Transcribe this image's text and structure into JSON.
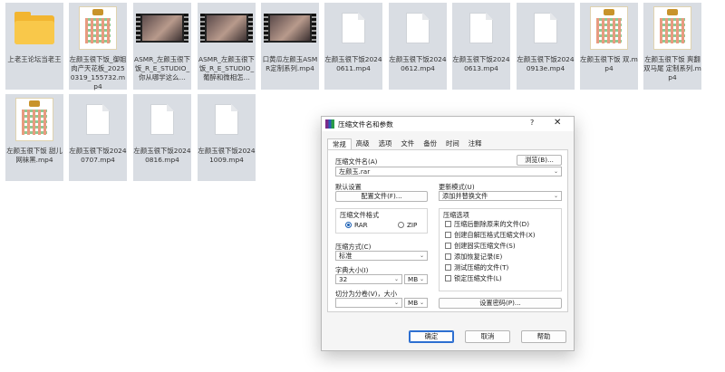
{
  "files": [
    {
      "name": "上老王论坛当老王",
      "kind": "folder"
    },
    {
      "name": "左颜玉很下饭_御姐肉产天花板_20250319_155732.mp4",
      "kind": "qr"
    },
    {
      "name": "ASMR_左颜玉很下饭_R_E_STUDIO_你从哪学这么…",
      "kind": "video"
    },
    {
      "name": "ASMR_左颜玉很下饭_R_E_STUDIO_葡醉和微相怎…",
      "kind": "video"
    },
    {
      "name": "口黄瓜左颜玉ASMR定制系列.mp4",
      "kind": "video"
    },
    {
      "name": "左颜玉很下饭20240611.mp4",
      "kind": "doc"
    },
    {
      "name": "左颜玉很下饭20240612.mp4",
      "kind": "doc"
    },
    {
      "name": "左颜玉很下饭20240613.mp4",
      "kind": "doc"
    },
    {
      "name": "左颜玉很下饭20240913e.mp4",
      "kind": "doc"
    },
    {
      "name": "左颜玉很下饭 双.mp4",
      "kind": "qr"
    },
    {
      "name": "左颜玉很下饭 爽翻双马尾 定制系列.mp4",
      "kind": "qr"
    },
    {
      "name": "左颜玉很下饭 甜儿 网袜黑.mp4",
      "kind": "qr"
    },
    {
      "name": "左颜玉很下饭20240707.mp4",
      "kind": "doc"
    },
    {
      "name": "左颜玉很下饭20240816.mp4",
      "kind": "doc"
    },
    {
      "name": "左颜玉很下饭20241009.mp4",
      "kind": "doc"
    }
  ],
  "dialog": {
    "title": "压缩文件名和参数",
    "help": "?",
    "close": "✕",
    "tabs": [
      "常规",
      "高级",
      "选项",
      "文件",
      "备份",
      "时间",
      "注释"
    ],
    "archive_name_label": "压缩文件名(A)",
    "archive_name_value": "左颜玉.rar",
    "browse_button": "浏览(B)...",
    "default_settings_label": "默认设置",
    "profiles_button": "配置文件(F)...",
    "update_mode_label": "更新模式(U)",
    "update_mode_value": "添加并替换文件",
    "format_label": "压缩文件格式",
    "format_rar": "RAR",
    "format_zip": "ZIP",
    "method_label": "压缩方式(C)",
    "method_value": "标准",
    "dict_label": "字典大小(I)",
    "dict_value": "32",
    "dict_unit": "MB",
    "split_label": "切分为分卷(V)，大小",
    "split_value": "",
    "split_unit": "MB",
    "options_label": "压缩选项",
    "options": [
      "压缩后删除原来的文件(D)",
      "创建自解压格式压缩文件(X)",
      "创建固实压缩文件(S)",
      "添加恢复记录(E)",
      "测试压缩的文件(T)",
      "锁定压缩文件(L)"
    ],
    "password_button": "设置密码(P)...",
    "ok_button": "确定",
    "cancel_button": "取消",
    "help_button": "帮助"
  }
}
